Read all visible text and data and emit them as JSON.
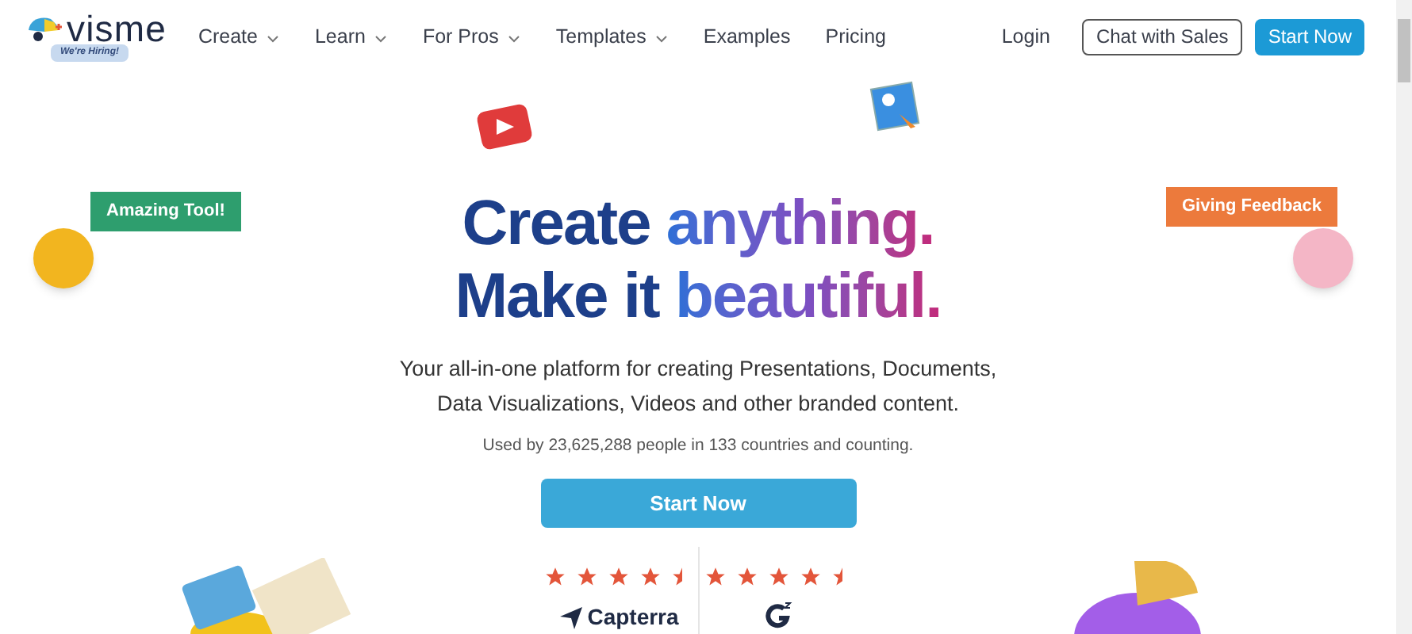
{
  "logo": {
    "wordmark": "visme",
    "badge": "We're Hiring!"
  },
  "nav": [
    {
      "label": "Create",
      "dropdown": true
    },
    {
      "label": "Learn",
      "dropdown": true
    },
    {
      "label": "For Pros",
      "dropdown": true
    },
    {
      "label": "Templates",
      "dropdown": true
    },
    {
      "label": "Examples",
      "dropdown": false
    },
    {
      "label": "Pricing",
      "dropdown": false
    }
  ],
  "actions": {
    "login": "Login",
    "chat": "Chat with Sales",
    "start": "Start Now"
  },
  "bubbles": [
    {
      "text": "Amazing Tool!",
      "color": "#2e9e6e"
    },
    {
      "text": "Giving Feedback",
      "color": "#ec7a3c"
    }
  ],
  "headline": [
    [
      {
        "text": "Create",
        "kind": "plain"
      },
      {
        "text": "anything.",
        "kind": "gradient"
      }
    ],
    [
      {
        "text": "Make it",
        "kind": "plain"
      },
      {
        "text": "beautiful.",
        "kind": "gradient"
      }
    ]
  ],
  "subtitle": [
    "Your all-in-one platform for creating Presentations, Documents,",
    "Data Visualizations, Videos and other branded content."
  ],
  "usage": "Used by 23,625,288 people in 133 countries and counting.",
  "cta": "Start Now",
  "ratings": [
    {
      "stars": 4.5,
      "kind": "capterra",
      "name": "Capterra"
    },
    {
      "stars": 4.5,
      "kind": "g2"
    }
  ]
}
